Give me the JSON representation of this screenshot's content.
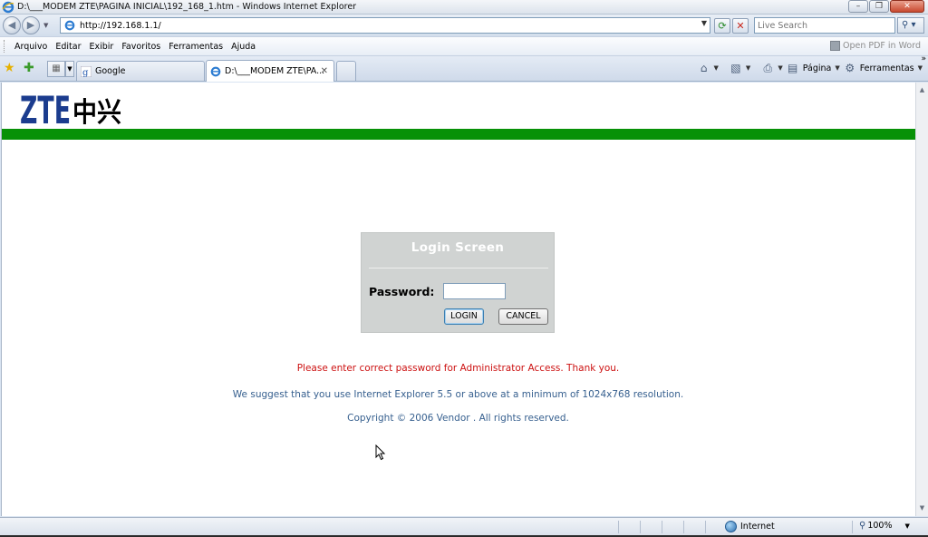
{
  "window": {
    "title": "D:\\___MODEM ZTE\\PAGINA INICIAL\\192_168_1.htm - Windows Internet Explorer",
    "minimize_label": "–",
    "maximize_label": "❐",
    "close_label": "✕"
  },
  "address_bar": {
    "url": "http://192.168.1.1/",
    "search_placeholder": "Live Search"
  },
  "menu": {
    "items": [
      "Arquivo",
      "Editar",
      "Exibir",
      "Favoritos",
      "Ferramentas",
      "Ajuda"
    ],
    "open_pdf_label": "Open PDF in Word"
  },
  "tabs": [
    {
      "label": "Google",
      "active": false
    },
    {
      "label": "D:\\___MODEM ZTE\\PA...",
      "active": true
    }
  ],
  "tab_close_label": "✕",
  "command_bar": {
    "page_label": "Página",
    "tools_label": "Ferramentas"
  },
  "page": {
    "logo_latin": "ZTE",
    "logo_chinese": "中兴",
    "login": {
      "title": "Login  Screen",
      "password_label": "Password:",
      "login_button": "LOGIN",
      "cancel_button": "CANCEL"
    },
    "error_message": "Please enter correct password for Administrator Access. Thank you.",
    "suggestion": "We suggest that you use Internet Explorer 5.5 or above at a minimum of 1024x768 resolution.",
    "copyright": "Copyright © 2006 Vendor . All rights reserved."
  },
  "status_bar": {
    "zone": "Internet",
    "zoom": "100%"
  },
  "colors": {
    "green_bar": "#079107",
    "logo_blue": "#1b3c8e",
    "error_red": "#cc1111",
    "info_blue": "#37608f",
    "login_panel": "#d0d3d2"
  }
}
